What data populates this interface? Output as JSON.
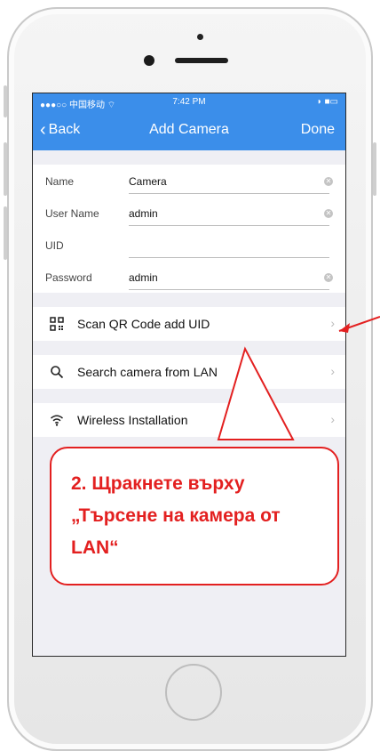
{
  "status_bar": {
    "left": "●●●○○ 中国移动 ⌔",
    "time": "7:42 PM",
    "right": "◗ ■▭"
  },
  "nav": {
    "back_label": "Back",
    "title": "Add Camera",
    "done_label": "Done"
  },
  "form": {
    "fields": [
      {
        "label": "Name",
        "value": "Camera"
      },
      {
        "label": "User Name",
        "value": "admin"
      },
      {
        "label": "UID",
        "value": ""
      },
      {
        "label": "Password",
        "value": "admin"
      }
    ]
  },
  "menu": {
    "items": [
      {
        "label": "Scan QR Code add UID",
        "icon": "qr-code-icon"
      },
      {
        "label": "Search camera from LAN",
        "icon": "search-icon"
      },
      {
        "label": "Wireless Installation",
        "icon": "wifi-icon"
      }
    ]
  },
  "annotation": {
    "text": "2. Щракнете върху „Търсене на камера от LAN“",
    "color": "#e32020"
  },
  "colors": {
    "nav_blue": "#3b8eea",
    "screen_bg": "#efeff4"
  }
}
